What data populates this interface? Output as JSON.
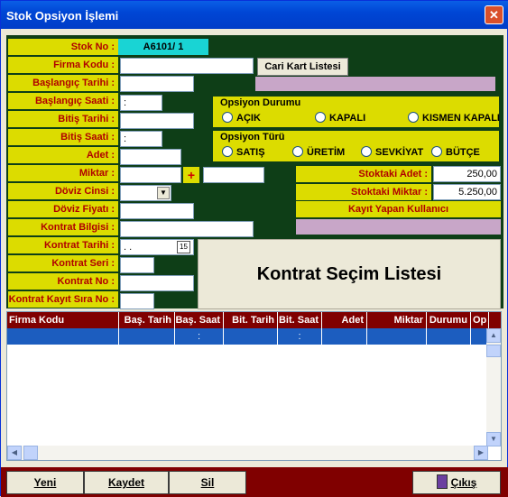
{
  "window": {
    "title": "Stok Opsiyon İşlemi",
    "close_glyph": "✕"
  },
  "labels": {
    "stok_no": "Stok No :",
    "firma_kodu": "Firma Kodu :",
    "baslangic_tarihi": "Başlangıç Tarihi :",
    "baslangic_saati": "Başlangıç Saati :",
    "bitis_tarihi": "Bitiş Tarihi :",
    "bitis_saati": "Bitiş Saati :",
    "adet": "Adet :",
    "miktar": "Miktar :",
    "doviz_cinsi": "Döviz Cinsi :",
    "doviz_fiyati": "Döviz Fiyatı :",
    "kontrat_bilgisi": "Kontrat Bilgisi :",
    "kontrat_tarihi": "Kontrat Tarihi :",
    "kontrat_seri": "Kontrat Seri :",
    "kontrat_no": "Kontrat No :",
    "kontrat_kayit_sira_no": "Kontrat Kayıt Sıra No :"
  },
  "values": {
    "stok_no": "A6101/ 1",
    "baslangic_saati": ":",
    "bitis_saati": ":",
    "kontrat_tarihi": ". .",
    "stoktaki_adet": "250,00",
    "stoktaki_miktar": "5.250,00",
    "plus": "+"
  },
  "buttons": {
    "cari_kart_listesi": "Cari Kart Listesi"
  },
  "opsiyon_durumu": {
    "title": "Opsiyon Durumu",
    "options": [
      "AÇIK",
      "KAPALI",
      "KISMEN KAPALI"
    ]
  },
  "opsiyon_turu": {
    "title": "Opsiyon Türü",
    "options": [
      "SATIŞ",
      "ÜRETİM",
      "SEVKİYAT",
      "BÜTÇE"
    ]
  },
  "stock": {
    "adet_label": "Stoktaki Adet :",
    "miktar_label": "Stoktaki Miktar :",
    "kullanici_label": "Kayıt Yapan Kullanıcı"
  },
  "kontrat_list_title": "Kontrat Seçim Listesi",
  "grid": {
    "columns": [
      "Firma Kodu",
      "Baş. Tarih",
      "Baş. Saat",
      "Bit. Tarih",
      "Bit. Saat",
      "Adet",
      "Miktar",
      "Durumu",
      "Op"
    ],
    "row": [
      "",
      "",
      ":",
      "",
      ":",
      "",
      "",
      "",
      ""
    ]
  },
  "footer": {
    "yeni": "Yeni",
    "kaydet": "Kaydet",
    "sil": "Sil",
    "cikis": "Çıkış"
  },
  "calendar_day": "15"
}
